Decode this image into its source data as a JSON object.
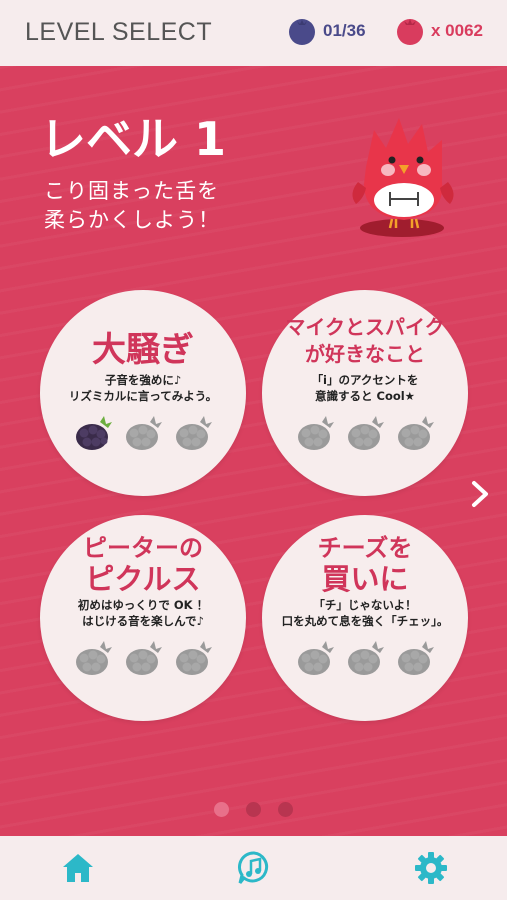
{
  "header": {
    "title": "LEVEL SELECT",
    "blueberry_count": "01/36",
    "raspberry_count": "x 0062"
  },
  "level": {
    "title": "レベル 1",
    "description": [
      "こり固まった舌を",
      "柔らかくしよう！"
    ]
  },
  "cards": [
    {
      "title": [
        "大騒ぎ"
      ],
      "description": [
        "子音を強めに♪",
        "リズミカルに言ってみよう。"
      ],
      "berries_earned": 1,
      "berries_total": 3
    },
    {
      "title": [
        "マイクとスパイク",
        "が好きなこと"
      ],
      "description": [
        "「i」のアクセントを",
        "意識すると Cool★"
      ],
      "berries_earned": 0,
      "berries_total": 3
    },
    {
      "title": [
        "ピーターの",
        "ピクルス"
      ],
      "description": [
        "初めはゆっくりで OK ！",
        "はじける音を楽しんで♪"
      ],
      "berries_earned": 0,
      "berries_total": 3
    },
    {
      "title": [
        "チーズを",
        "買いに"
      ],
      "description": [
        "「チ」じゃないよ！",
        "口を丸めて息を強く「チェッ」。"
      ],
      "berries_earned": 0,
      "berries_total": 3
    }
  ],
  "pager": {
    "current_page": 1,
    "total_pages": 3
  },
  "navigation": {
    "next_icon": "chevron-right-icon",
    "footer_icons": [
      "home-icon",
      "music-note-icon",
      "gear-icon"
    ]
  },
  "colors": {
    "background": "#d9405f",
    "header_bg": "#f6eced",
    "accent_teal": "#2cb8c8",
    "card_bg": "#f7eded",
    "title_red": "#d0355a",
    "blueberry": "#4a4a8a",
    "berry_inactive": "#9a9a9a",
    "berry_active": "#3a2b4a"
  }
}
